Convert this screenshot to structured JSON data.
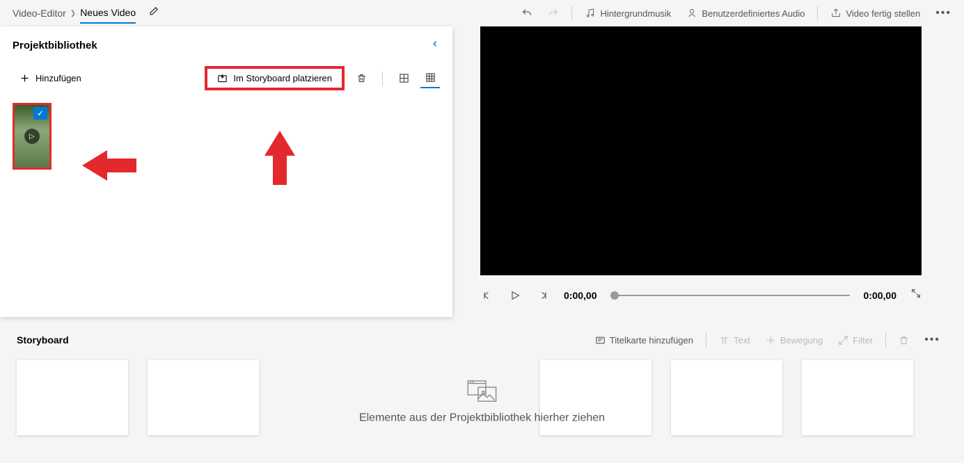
{
  "breadcrumb": {
    "app": "Video-Editor",
    "title": "Neues Video"
  },
  "topbar": {
    "bg_music": "Hintergrundmusik",
    "custom_audio": "Benutzerdefiniertes Audio",
    "finish": "Video fertig stellen"
  },
  "library": {
    "title": "Projektbibliothek",
    "add": "Hinzufügen",
    "place": "Im Storyboard platzieren"
  },
  "player": {
    "time_current": "0:00,00",
    "time_total": "0:00,00"
  },
  "storyboard": {
    "title": "Storyboard",
    "titlecard": "Titelkarte hinzufügen",
    "text": "Text",
    "motion": "Bewegung",
    "filter": "Filter",
    "drop_hint": "Elemente aus der Projektbibliothek hierher ziehen"
  }
}
